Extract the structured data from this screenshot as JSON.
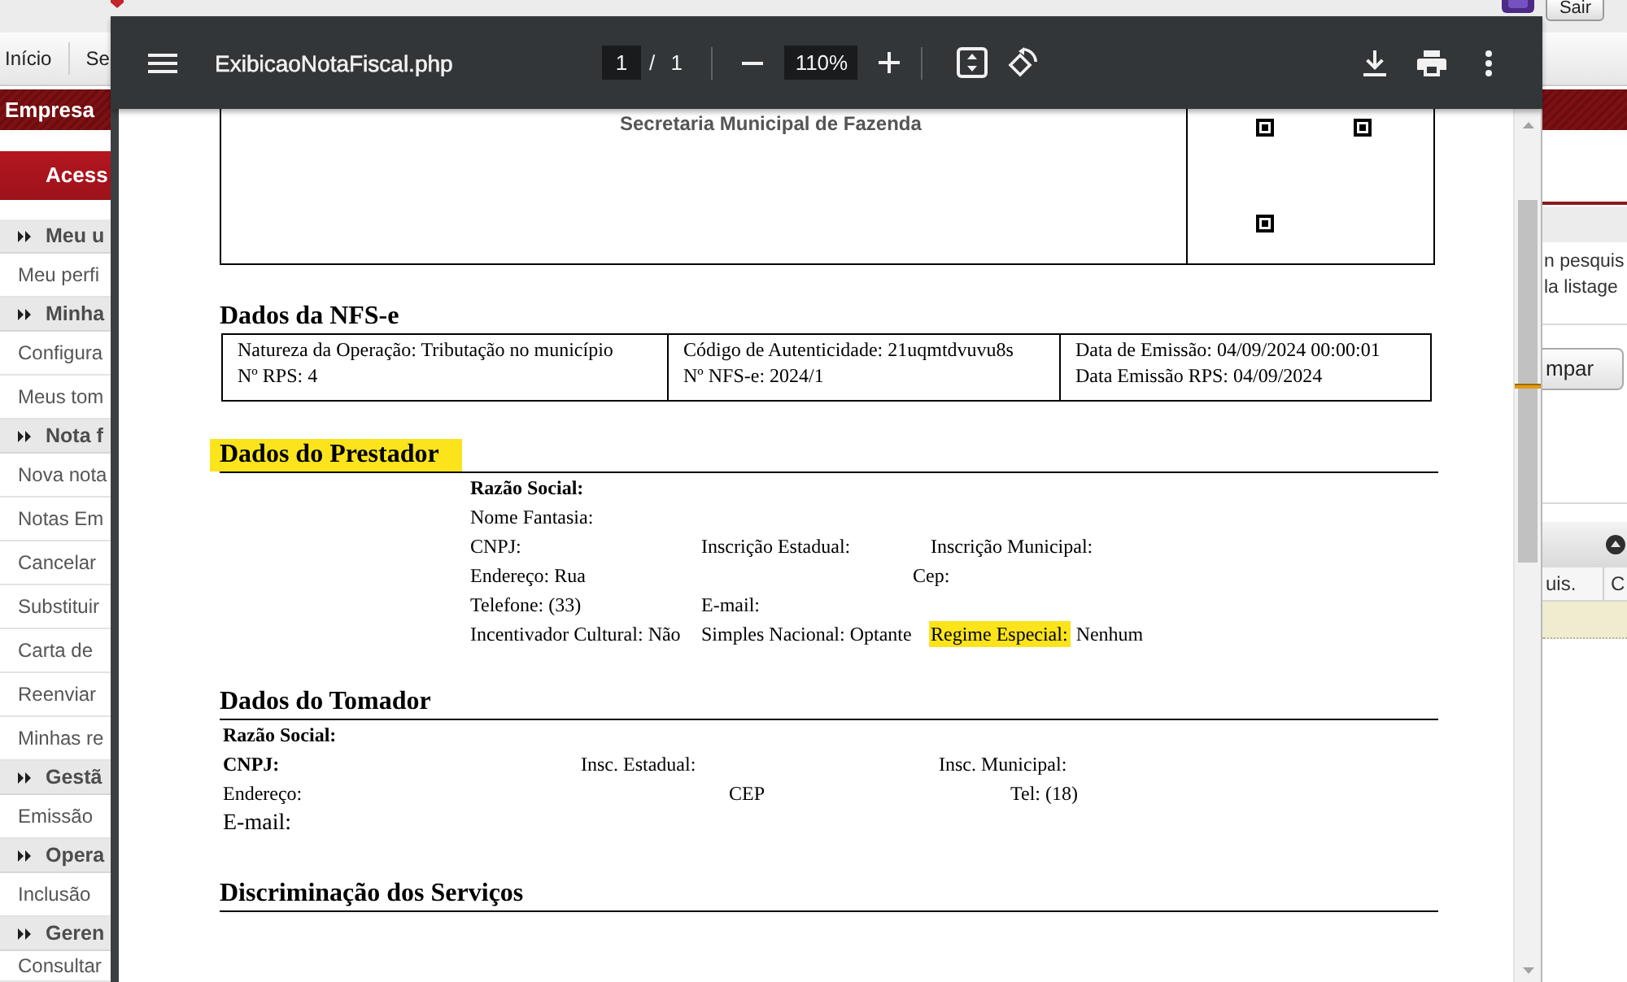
{
  "app": {
    "logout_button": "Sair",
    "nav": [
      {
        "label": "Início"
      },
      {
        "label": "Se"
      }
    ],
    "company_bar": "Empresa",
    "access_button": "Acess",
    "sidebar": [
      {
        "kind": "header",
        "label": "Meu u"
      },
      {
        "kind": "item",
        "label": "Meu perfi"
      },
      {
        "kind": "header",
        "label": "Minha"
      },
      {
        "kind": "item",
        "label": "Configura"
      },
      {
        "kind": "item",
        "label": "Meus tom"
      },
      {
        "kind": "header",
        "label": "Nota f"
      },
      {
        "kind": "item",
        "label": "Nova nota"
      },
      {
        "kind": "item",
        "label": "Notas Em"
      },
      {
        "kind": "item",
        "label": "Cancelar"
      },
      {
        "kind": "item",
        "label": "Substituir"
      },
      {
        "kind": "item",
        "label": "Carta de"
      },
      {
        "kind": "item",
        "label": "Reenviar"
      },
      {
        "kind": "item",
        "label": "Minhas re"
      },
      {
        "kind": "header",
        "label": "Gestã"
      },
      {
        "kind": "item",
        "label": "Emissão"
      },
      {
        "kind": "header",
        "label": "Opera"
      },
      {
        "kind": "item",
        "label": "Inclusão"
      },
      {
        "kind": "header",
        "label": "Geren"
      },
      {
        "kind": "item",
        "label": "Consultar"
      }
    ],
    "panel": {
      "help_lines": [
        "n pesquis",
        "la listage"
      ],
      "clear_button": "mpar",
      "grid_columns": [
        "uis.",
        "C"
      ]
    }
  },
  "viewer": {
    "title": "ExibicaoNotaFiscal.php",
    "page": "1",
    "page_total": "/ 1",
    "zoom": "110%",
    "document": {
      "agency": "Secretaria Municipal de Fazenda",
      "nfse": {
        "title": "Dados da NFS-e",
        "highlighted": false,
        "cells": [
          [
            "Natureza da Operação: Tributação no município",
            "Nº RPS: 4"
          ],
          [
            "Código de Autenticidade: 21uqmtdvuvu8s",
            "Nº NFS-e: 2024/1"
          ],
          [
            "Data de Emissão: 04/09/2024 00:00:01",
            "Data Emissão RPS: 04/09/2024"
          ]
        ]
      },
      "provider": {
        "title": "Dados do Prestador",
        "highlighted": true,
        "rows": [
          [
            {
              "label": "Razão Social:",
              "bold": true,
              "highlighted": false
            }
          ],
          [
            {
              "label": "Nome Fantasia:",
              "bold": false,
              "highlighted": false
            }
          ],
          [
            {
              "label": "CNPJ:",
              "bold": false,
              "highlighted": false
            },
            {
              "label": "Inscrição Estadual:",
              "bold": false,
              "highlighted": false
            },
            {
              "label": "Inscrição Municipal:",
              "bold": false,
              "highlighted": false
            }
          ],
          [
            {
              "label": "Endereço:",
              "value": "Rua",
              "bold": false,
              "highlighted": false
            },
            {
              "label": "Cep:",
              "bold": false,
              "highlighted": false
            }
          ],
          [
            {
              "label": "Telefone:",
              "value": "(33)",
              "bold": false,
              "highlighted": false
            },
            {
              "label": "E-mail:",
              "bold": false,
              "highlighted": false
            }
          ],
          [
            {
              "label": "Incentivador Cultural:",
              "value": "Não",
              "bold": false,
              "highlighted": false
            },
            {
              "label": "Simples Nacional:",
              "value": "Optante",
              "bold": false,
              "highlighted": false
            },
            {
              "label": "Regime Especial:",
              "value": "Nenhum",
              "bold": false,
              "highlighted": true
            }
          ]
        ]
      },
      "recipient": {
        "title": "Dados do Tomador",
        "highlighted": false,
        "rows": [
          [
            {
              "label": "Razão Social:",
              "bold": true,
              "highlighted": false
            }
          ],
          [
            {
              "label": "CNPJ:",
              "bold": true,
              "highlighted": false
            },
            {
              "label": "Insc. Estadual:",
              "bold": false,
              "highlighted": false
            },
            {
              "label": "Insc. Municipal:",
              "bold": false,
              "highlighted": false
            }
          ],
          [
            {
              "label": "Endereço:",
              "bold": false,
              "highlighted": false
            },
            {
              "label": "CEP",
              "bold": false,
              "highlighted": false
            },
            {
              "label": "Tel:",
              "value": "(18)",
              "bold": false,
              "highlighted": false
            }
          ],
          [
            {
              "label": "E-mail:",
              "bold": false,
              "highlighted": false
            }
          ]
        ]
      },
      "services": {
        "title": "Discriminação dos Serviços",
        "highlighted": false
      }
    }
  }
}
